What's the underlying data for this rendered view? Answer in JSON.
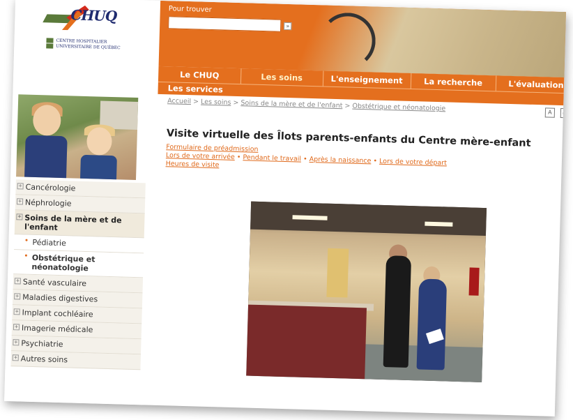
{
  "logo": {
    "brand": "CHUQ",
    "sub_line1": "CENTRE HOSPITALIER",
    "sub_line2": "UNIVERSITAIRE DE QUÉBEC"
  },
  "search": {
    "label": "Pour trouver",
    "value": "",
    "button": "»"
  },
  "nav": {
    "tabs": [
      "Le CHUQ",
      "Les soins",
      "L'enseignement",
      "La recherche",
      "L'évaluation"
    ],
    "active_tab": "Les soins",
    "second_row": "Les services"
  },
  "breadcrumb": {
    "items": [
      "Accueil",
      "Les soins",
      "Soins de la mère et de l'enfant",
      "Obstétrique et néonatologie"
    ],
    "separator": ">"
  },
  "tools": {
    "font_icon": "text-size-icon",
    "print_icon": "print-icon"
  },
  "sidebar": {
    "items": [
      {
        "label": "Cancérologie",
        "level": 1
      },
      {
        "label": "Néphrologie",
        "level": 1
      },
      {
        "label": "Soins de la mère et de l'enfant",
        "level": 1,
        "active": true
      },
      {
        "label": "Pédiatrie",
        "level": 2
      },
      {
        "label": "Obstétrique et néonatologie",
        "level": 2,
        "active": true
      },
      {
        "label": "Santé vasculaire",
        "level": 1
      },
      {
        "label": "Maladies digestives",
        "level": 1
      },
      {
        "label": "Implant cochléaire",
        "level": 1
      },
      {
        "label": "Imagerie médicale",
        "level": 1
      },
      {
        "label": "Psychiatrie",
        "level": 1
      },
      {
        "label": "Autres soins",
        "level": 1
      }
    ]
  },
  "main": {
    "title": "Visite virtuelle des Îlots parents-enfants du Centre mère-enfant",
    "link_row1": "Formulaire de préadmission",
    "link_row2": [
      "Lors de votre arrivée",
      "Pendant le travail",
      "Après la naissance",
      "Lors de votre départ"
    ],
    "link_sep": "•",
    "link_row3": "Heures de visite"
  },
  "colors": {
    "accent": "#e46f1e",
    "link": "#e06a1c",
    "brand_blue": "#1f2b6f"
  }
}
